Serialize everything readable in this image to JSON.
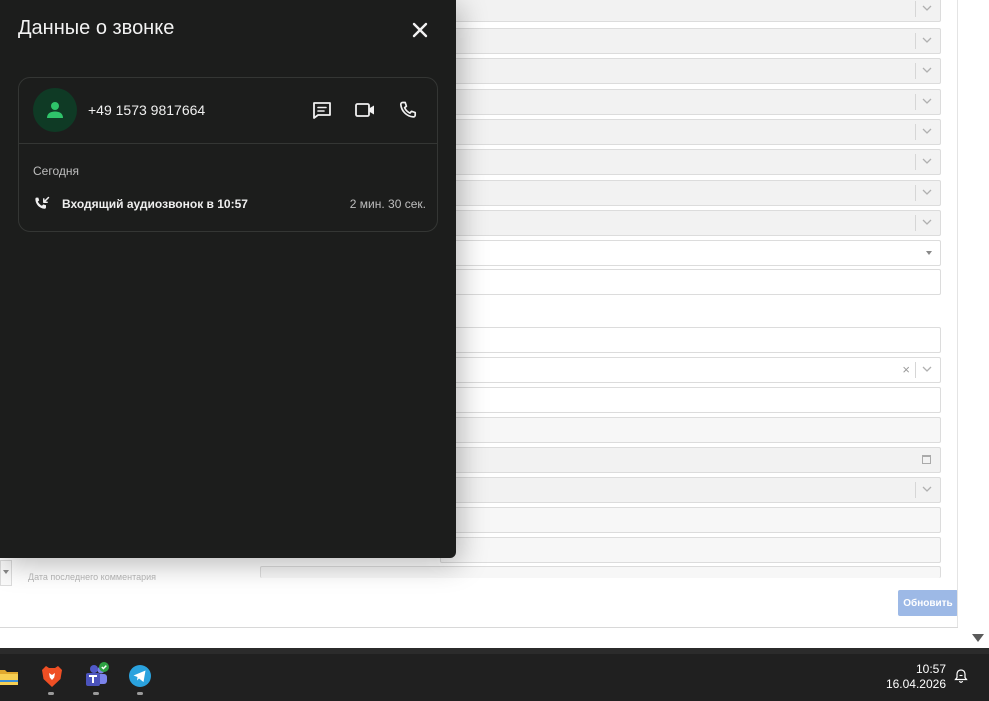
{
  "panel": {
    "title": "Данные о звонке"
  },
  "contact": {
    "phone": "+49 1573 9817664",
    "actions": [
      "message-icon",
      "video-call-icon",
      "phone-icon"
    ]
  },
  "history": {
    "day_label": "Сегодня",
    "entries": [
      {
        "description": "Входящий аудиозвонок в 10:57",
        "duration": "2 мин. 30 сек.",
        "icon": "incoming-call-icon"
      }
    ]
  },
  "background_form": {
    "update_button": "Обновить",
    "obscured_label": "Дата последнего комментария"
  },
  "taskbar": {
    "apps": [
      "file-explorer-icon",
      "brave-browser-icon",
      "teams-icon",
      "telegram-icon"
    ],
    "time": "10:57",
    "date": "16.04.2026"
  },
  "colors": {
    "panel_bg": "#1c1d1c",
    "avatar_bg": "#0f3a25",
    "avatar_fg": "#2fc36a",
    "update_button_bg": "#9db9e6",
    "taskbar_bg": "#202020"
  }
}
